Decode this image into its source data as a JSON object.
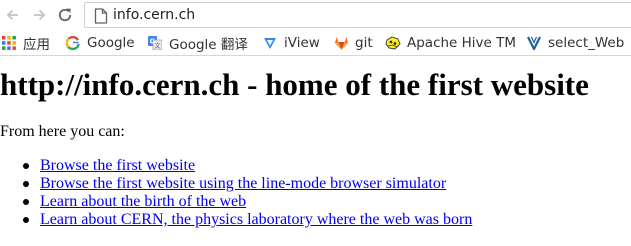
{
  "address_bar": {
    "url": "info.cern.ch"
  },
  "bookmarks": [
    {
      "label": "应用",
      "icon": "apps-grid-icon"
    },
    {
      "label": "Google",
      "icon": "google-icon"
    },
    {
      "label": "Google 翻译",
      "icon": "google-translate-icon"
    },
    {
      "label": "iView",
      "icon": "iview-icon"
    },
    {
      "label": "git",
      "icon": "gitlab-icon"
    },
    {
      "label": "Apache Hive TM",
      "icon": "hive-icon"
    },
    {
      "label": "select_Web",
      "icon": "v-icon"
    }
  ],
  "page": {
    "title": "http://info.cern.ch - home of the first website",
    "intro": "From here you can:",
    "links": [
      "Browse the first website",
      "Browse the first website using the line-mode browser simulator",
      "Learn about the birth of the web",
      "Learn about CERN, the physics laboratory where the web was born"
    ]
  },
  "colors": {
    "link": "#0000ee",
    "text": "#000000",
    "chrome_border": "#d6d6d6"
  }
}
